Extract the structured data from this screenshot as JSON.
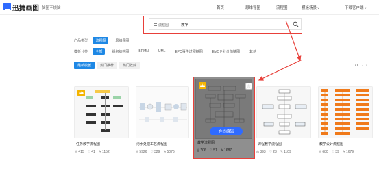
{
  "header": {
    "logo_text": "迅捷画图",
    "slogan": "脑图不烧脑",
    "nav": [
      {
        "label": "首页"
      },
      {
        "label": "思维导图"
      },
      {
        "label": "流程图"
      },
      {
        "label": "模板场景"
      },
      {
        "label": "下载客户端"
      }
    ]
  },
  "search": {
    "type_label": "流程图",
    "query": "教学"
  },
  "filters": {
    "product_label": "产品类型:",
    "product_options": [
      {
        "label": "流程图",
        "active": true
      },
      {
        "label": "思维导图",
        "active": false
      }
    ],
    "category_label": "模板分类:",
    "category_options": [
      {
        "label": "全部",
        "active": true
      },
      {
        "label": "组织结构图",
        "active": false
      },
      {
        "label": "BPMN",
        "active": false
      },
      {
        "label": "UML",
        "active": false
      },
      {
        "label": "EPC事件过程链图",
        "active": false
      },
      {
        "label": "EVC企业价值链图",
        "active": false
      },
      {
        "label": "其他",
        "active": false
      }
    ]
  },
  "sort_tabs": [
    {
      "label": "最新模板",
      "active": true
    },
    {
      "label": "热门推荐",
      "active": false
    },
    {
      "label": "热门收藏",
      "active": false
    }
  ],
  "pagination": {
    "label": "1/1"
  },
  "cards": [
    {
      "title": "任务教学流程图",
      "views": "415",
      "likes": "41",
      "uses": "1152"
    },
    {
      "title": "污水处理工艺流程图",
      "views": "5926",
      "likes": "329",
      "uses": "5076"
    },
    {
      "title": "教学流程图",
      "views": "706",
      "likes": "51",
      "uses": "1687",
      "button": "在线编辑"
    },
    {
      "title": "课程教学流程图",
      "views": "393",
      "likes": "23",
      "uses": "1109"
    },
    {
      "title": "教学设计流程图",
      "views": "680",
      "likes": "39",
      "uses": "1679"
    }
  ],
  "colors": {
    "accent": "#1e88e5",
    "highlight": "#e8403a",
    "brand": "#2f6bff",
    "crown": "#f4b400",
    "orange_flow": "#f07a1a"
  }
}
